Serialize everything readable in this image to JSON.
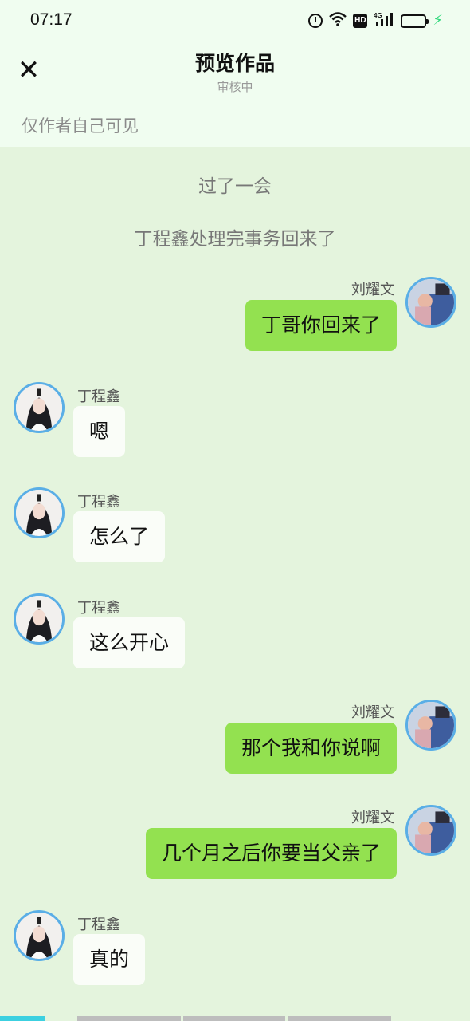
{
  "status_bar": {
    "time": "07:17",
    "hd_label": "HD",
    "network_label": "4G",
    "icons": [
      "alarm-icon",
      "wifi-icon",
      "hd-icon",
      "signal-icon",
      "battery-icon",
      "charging-icon"
    ],
    "battery_color": "#2ed87a"
  },
  "header": {
    "title": "预览作品",
    "subtitle": "审核中",
    "close_icon": "close-icon",
    "visibility_note": "仅作者自己可见"
  },
  "narration": [
    "过了一会",
    "丁程鑫处理完事务回来了"
  ],
  "messages": [
    {
      "side": "right",
      "sender": "刘耀文",
      "text": "丁哥你回来了"
    },
    {
      "side": "left",
      "sender": "丁程鑫",
      "text": "嗯"
    },
    {
      "side": "left",
      "sender": "丁程鑫",
      "text": "怎么了"
    },
    {
      "side": "left",
      "sender": "丁程鑫",
      "text": "这么开心"
    },
    {
      "side": "right",
      "sender": "刘耀文",
      "text": "那个我和你说啊"
    },
    {
      "side": "right",
      "sender": "刘耀文",
      "text": "几个月之后你要当父亲了"
    },
    {
      "side": "left",
      "sender": "丁程鑫",
      "text": "真的"
    }
  ],
  "colors": {
    "background": "#e4f4dd",
    "header_bg": "#f0fdf0",
    "bubble_right": "#93e150",
    "bubble_left": "#fafdf8",
    "avatar_border": "#5aaee6",
    "progress_active": "#3cd0e0",
    "progress_inactive": "#bdbdbd"
  }
}
